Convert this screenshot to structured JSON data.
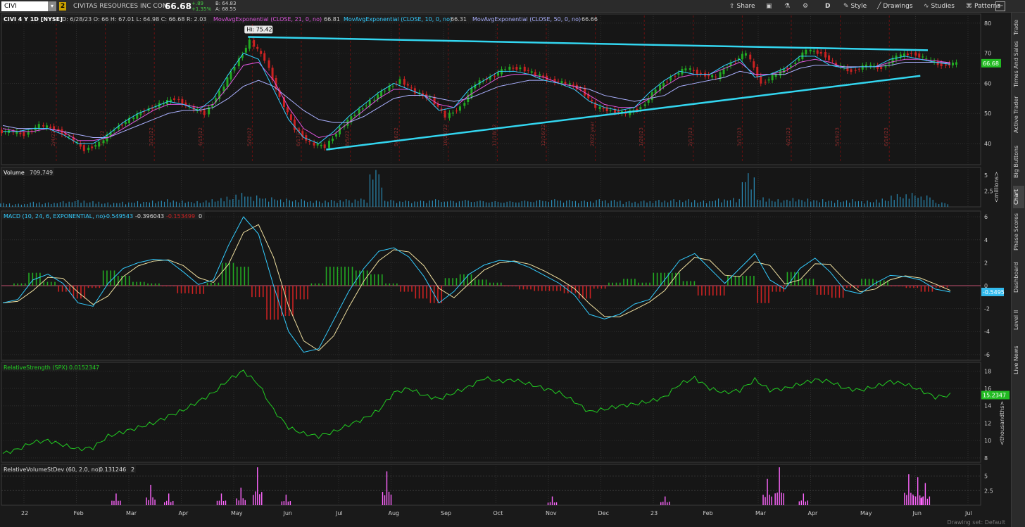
{
  "toolbar": {
    "symbol": "CIVI",
    "badge": "2",
    "company": "CIVITAS RESOURCES INC COM",
    "last": "66.68",
    "change": "+.89",
    "change_pct": "+1.35%",
    "bid": "B: 64.83",
    "ask": "A: 68.55",
    "share": "Share",
    "period": "D",
    "style": "Style",
    "drawings": "Drawings",
    "studies": "Studies",
    "patterns": "Patterns",
    "icons": [
      "share-icon",
      "settings-icon",
      "flask-icon",
      "gear-icon",
      "pencil-icon",
      "studies-icon",
      "patterns-icon"
    ]
  },
  "sidebar": [
    "Trade",
    "Times And Sales",
    "Active Trader",
    "Big Buttons",
    "Chart",
    "Phase Scores",
    "Dashboard",
    "Level II",
    "Live News"
  ],
  "sidebar_active": "Chart",
  "price_header": {
    "title": "CIVI 4 Y 1D [NYSE]",
    "ohlc": "D: 6/28/23   O: 66   H: 67.01   L: 64.98   C: 66.68   R: 2.03",
    "ema21": "MovAvgExponential (CLOSE, 21, 0, no)",
    "ema21_val": "66.81",
    "ema10": "MovAvgExponential (CLOSE, 10, 0, no)",
    "ema10_val": "66.31",
    "ema50": "MovAvgExponential (CLOSE, 50, 0, no)",
    "ema50_val": "66.66",
    "hi_label": "Hi: 75.42"
  },
  "price_axis": {
    "ticks": [
      "80",
      "70",
      "60",
      "50",
      "40"
    ],
    "last_label": "66.68",
    "colors": {
      "up": "#00c000",
      "down": "#e00000"
    }
  },
  "volume_header": {
    "title": "Volume",
    "value": "709,749"
  },
  "volume_axis": {
    "ticks": [
      "5",
      "2.5"
    ],
    "unit": "<millions>"
  },
  "macd_header": {
    "title": "MACD (10, 24, 6, EXPONENTIAL, no)",
    "v1": "-0.549543",
    "v2": "-0.396043",
    "v3": "-0.153499",
    "v4": "0"
  },
  "macd_axis": {
    "ticks": [
      "6",
      "4",
      "2",
      "0",
      "-2",
      "-4",
      "-6"
    ],
    "last_label": "-0.5495"
  },
  "rs_header": {
    "title": "RelativeStrength (SPX)",
    "value": "0.0152347"
  },
  "rs_axis": {
    "ticks": [
      "18",
      "16",
      "14",
      "12",
      "10",
      "8"
    ],
    "last_label": "15.2347",
    "unit": "<thousandths>"
  },
  "rvol_header": {
    "title": "RelativeVolumeStDev (60, 2.0, no)",
    "value": "0.131246",
    "extra": "2"
  },
  "rvol_axis": {
    "ticks": [
      "5",
      "2.5"
    ]
  },
  "x_axis": [
    "22",
    "Feb",
    "Mar",
    "Apr",
    "May",
    "Jun",
    "Jul",
    "Aug",
    "Sep",
    "Oct",
    "Nov",
    "Dec",
    "23",
    "Feb",
    "Mar",
    "Apr",
    "May",
    "Jun",
    "Jul"
  ],
  "date_markers": [
    "2/4/22",
    "3/3/22",
    "3/31/22",
    "4/15/22",
    "5/20/22",
    "6/17/22",
    "8/5/22",
    "9/16/22",
    "10/21/22",
    "11/18/22",
    "12/16/22",
    "2022 year",
    "1/20/23",
    "2/17/23",
    "3/17/23",
    "4/21/23",
    "5/19/23",
    "6/16/23"
  ],
  "footer": "Drawing set: Default",
  "chart_data": {
    "type": "line",
    "x_labels": [
      "22",
      "Feb",
      "Mar",
      "Apr",
      "May",
      "Jun",
      "Jul",
      "Aug",
      "Sep",
      "Oct",
      "Nov",
      "Dec",
      "23",
      "Feb",
      "Mar",
      "Apr",
      "May",
      "Jun",
      "Jul"
    ],
    "price_close": [
      44,
      43,
      46,
      45,
      42,
      38,
      40,
      45,
      48,
      51,
      53,
      55,
      52,
      50,
      57,
      66,
      74,
      68,
      55,
      45,
      40,
      39,
      45,
      50,
      54,
      58,
      61,
      57,
      55,
      49,
      52,
      60,
      62,
      65,
      65,
      63,
      61,
      60,
      58,
      52,
      51,
      50,
      52,
      58,
      62,
      65,
      63,
      62,
      67,
      70,
      60,
      63,
      66,
      71,
      70,
      66,
      64,
      66,
      65,
      69,
      70,
      68,
      66,
      66.68
    ],
    "ema10": [
      44,
      44,
      45,
      45,
      43,
      40,
      40,
      43,
      47,
      50,
      52,
      54,
      53,
      51,
      55,
      63,
      70,
      68,
      58,
      48,
      42,
      40,
      44,
      49,
      53,
      57,
      60,
      58,
      56,
      51,
      52,
      58,
      61,
      64,
      64,
      63,
      61,
      60,
      58,
      54,
      52,
      51,
      52,
      57,
      61,
      64,
      63,
      63,
      66,
      68,
      62,
      63,
      65,
      69,
      69,
      66,
      65,
      65.5,
      65.5,
      68,
      69,
      68,
      67,
      66.31
    ],
    "ema21": [
      45,
      44,
      44,
      45,
      44,
      41,
      41,
      42,
      45,
      48,
      51,
      53,
      53,
      52,
      53,
      59,
      66,
      67,
      61,
      52,
      45,
      42,
      43,
      47,
      51,
      55,
      58,
      58,
      56,
      53,
      52,
      56,
      59,
      62,
      63,
      63,
      62,
      60,
      59,
      56,
      53,
      52,
      52,
      55,
      59,
      62,
      63,
      63,
      65,
      67,
      63,
      63,
      64,
      67,
      68,
      67,
      65,
      65.5,
      65.5,
      67,
      68,
      68,
      67.5,
      66.81
    ],
    "ema50": [
      46,
      45,
      45,
      45,
      44,
      43,
      42,
      42,
      44,
      46,
      48,
      50,
      51,
      51,
      52,
      55,
      59,
      61,
      59,
      55,
      51,
      48,
      47,
      47,
      49,
      52,
      55,
      56,
      56,
      55,
      54,
      55,
      57,
      59,
      60,
      61,
      61,
      60,
      59,
      58,
      56,
      55,
      54,
      55,
      56,
      59,
      60,
      61,
      62,
      64,
      63,
      63,
      63,
      65,
      66,
      66,
      65.5,
      65.5,
      65.5,
      66,
      67,
      67,
      67,
      66.66
    ],
    "trendline_upper": [
      [
        16.3,
        75.42
      ],
      [
        61.5,
        71
      ]
    ],
    "trendline_lower": [
      [
        21.5,
        38
      ],
      [
        61.0,
        62.5
      ]
    ],
    "hi": 75.42,
    "price_ylim": [
      33,
      83
    ],
    "volume_m": [
      0.6,
      0.5,
      0.8,
      0.7,
      0.9,
      1.1,
      0.9,
      0.7,
      0.8,
      0.9,
      1.0,
      1.2,
      1.0,
      0.9,
      1.2,
      1.6,
      2.2,
      1.8,
      1.5,
      1.3,
      1.2,
      1.0,
      1.1,
      1.2,
      1.3,
      5.8,
      1.1,
      1.0,
      1.0,
      1.2,
      1.0,
      1.1,
      1.0,
      0.9,
      0.9,
      1.0,
      1.1,
      1.2,
      1.1,
      1.0,
      1.2,
      1.1,
      0.9,
      1.0,
      1.1,
      1.2,
      1.2,
      1.0,
      1.3,
      1.4,
      5.3,
      1.5,
      1.2,
      1.4,
      1.3,
      1.2,
      1.1,
      1.2,
      1.0,
      1.3,
      2.0,
      2.2,
      1.8,
      0.7
    ],
    "macd": [
      -1.5,
      -1.2,
      0.5,
      1.0,
      0.2,
      -1.5,
      -1.8,
      0.2,
      1.5,
      2.0,
      2.3,
      2.2,
      1.2,
      0.1,
      0.5,
      3.5,
      6.0,
      4.5,
      0.0,
      -4.0,
      -5.8,
      -5.5,
      -3.0,
      -0.5,
      1.5,
      3.0,
      3.3,
      2.5,
      0.8,
      -1.5,
      -0.5,
      1.0,
      1.8,
      2.2,
      2.1,
      1.6,
      0.9,
      0.2,
      -0.8,
      -2.5,
      -2.9,
      -2.5,
      -1.6,
      -1.2,
      0.5,
      2.2,
      2.8,
      1.5,
      0.2,
      1.5,
      2.8,
      0.5,
      -0.3,
      1.5,
      2.4,
      1.2,
      -0.4,
      -0.7,
      0.2,
      0.9,
      0.8,
      0.5,
      -0.3,
      -0.55
    ],
    "macd_ylim": [
      -6.5,
      6.5
    ],
    "relative_strength": [
      8.5,
      9.0,
      9.8,
      10.0,
      9.5,
      9.0,
      9.2,
      10.5,
      11.0,
      11.5,
      12.0,
      12.8,
      13.5,
      14.5,
      15.5,
      17.0,
      18.0,
      16.5,
      13.5,
      11.5,
      10.8,
      10.5,
      11.0,
      11.8,
      12.5,
      13.5,
      15.5,
      16.0,
      15.2,
      14.8,
      15.5,
      16.2,
      17.2,
      16.8,
      17.0,
      16.5,
      16.0,
      15.5,
      14.5,
      13.3,
      13.6,
      14.0,
      14.2,
      14.5,
      15.0,
      16.5,
      17.2,
      16.0,
      15.5,
      15.8,
      17.0,
      15.8,
      16.0,
      16.5,
      17.0,
      16.8,
      16.0,
      15.8,
      16.2,
      16.8,
      16.5,
      15.8,
      15.0,
      15.23
    ],
    "rs_ylim": [
      7.5,
      19
    ],
    "rvol_spikes": [
      [
        7.5,
        2.0
      ],
      [
        9.8,
        3.5
      ],
      [
        11.0,
        2.0
      ],
      [
        14.5,
        2.0
      ],
      [
        15.8,
        3.0
      ],
      [
        16.9,
        6.5
      ],
      [
        18.8,
        1.8
      ],
      [
        25.5,
        5.8
      ],
      [
        36.5,
        1.5
      ],
      [
        44.0,
        1.5
      ],
      [
        50.8,
        4.5
      ],
      [
        51.6,
        6.5
      ],
      [
        53.2,
        2.0
      ],
      [
        60.2,
        5.3
      ],
      [
        60.8,
        4.8
      ],
      [
        61.3,
        3.8
      ]
    ],
    "rvol_ylim": [
      0,
      7
    ],
    "colors": {
      "price_line": "#ffffff",
      "ema10": "#33ccff",
      "ema21": "#dd55dd",
      "ema50": "#aab0ff",
      "trend": "#33d6f0",
      "macd": "#33ccff",
      "signal": "#f0e0a0",
      "hist_up": "#22aa22",
      "hist_down": "#cc2222",
      "rs": "#22cc22",
      "rvol": "#ff66ff",
      "volume": "#2a8bb5"
    }
  }
}
